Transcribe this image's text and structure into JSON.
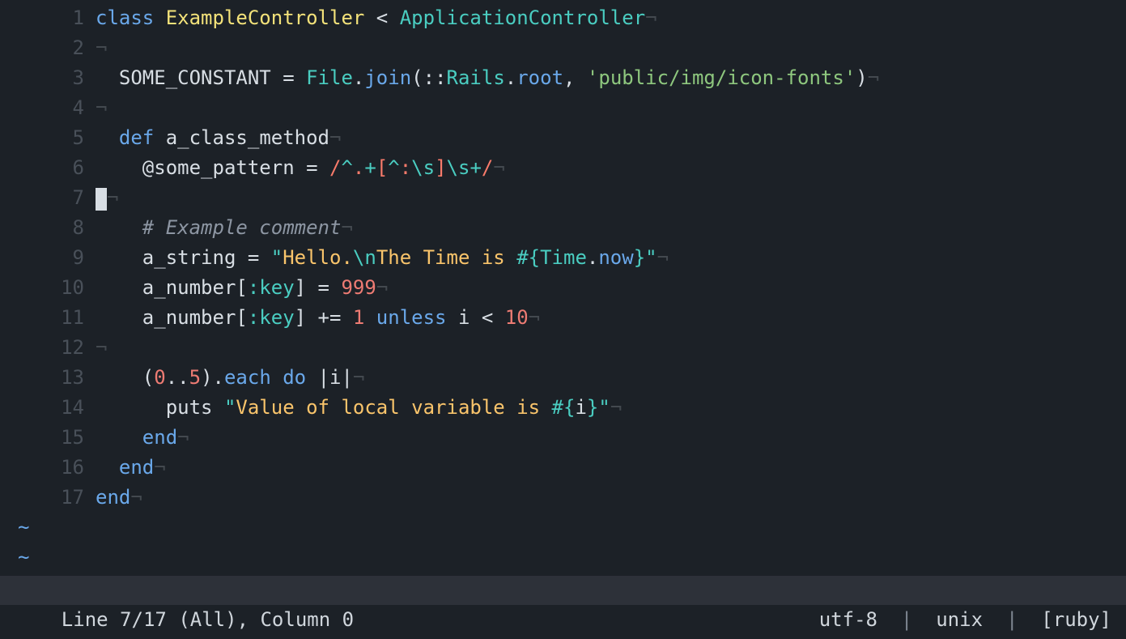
{
  "cursor": {
    "line": 7,
    "col": 0
  },
  "total_lines": 17,
  "lines": {
    "1": {
      "indent": 0,
      "segs": [
        {
          "cls": "kw",
          "t": "class"
        },
        {
          "cls": "clsname",
          "t": "ExampleController"
        },
        {
          "cls": "op",
          "t": "<"
        },
        {
          "cls": "parent",
          "t": "ApplicationController"
        }
      ]
    },
    "2": {
      "indent": 0,
      "segs": [],
      "blank": true
    },
    "3": {
      "indent": 2,
      "raw": true
    },
    "4": {
      "indent": 0,
      "segs": [],
      "blank": true
    },
    "5": {
      "indent": 2,
      "segs": [
        {
          "cls": "kw",
          "t": "def"
        },
        {
          "cls": "id",
          "t": "a_class_method"
        }
      ]
    },
    "6": {
      "indent": 4,
      "raw6": true
    },
    "7": {
      "indent": 0,
      "cursor": true
    },
    "8": {
      "indent": 4,
      "segs": [
        {
          "cls": "comment",
          "t": "# Example comment"
        }
      ]
    },
    "9": {
      "indent": 4,
      "raw9": true
    },
    "10": {
      "indent": 4,
      "raw10": true
    },
    "11": {
      "indent": 4,
      "raw11": true
    },
    "12": {
      "indent": 0,
      "segs": [],
      "blank": true
    },
    "13": {
      "indent": 4,
      "raw13": true
    },
    "14": {
      "indent": 6,
      "raw14": true
    },
    "15": {
      "indent": 4,
      "segs": [
        {
          "cls": "kw",
          "t": "end"
        }
      ]
    },
    "16": {
      "indent": 2,
      "segs": [
        {
          "cls": "kw",
          "t": "end"
        }
      ]
    },
    "17": {
      "indent": 0,
      "segs": [
        {
          "cls": "kw",
          "t": "end"
        }
      ]
    }
  },
  "tokens": {
    "l3": {
      "const": "SOME_CONSTANT",
      "eq": " = ",
      "klass": "File",
      "dot": ".",
      "method": "join",
      "p_open": "(",
      "cc": "::",
      "klass2": "Rails",
      "method2": "root",
      "comma": ", ",
      "q": "'",
      "str": "public/img/icon-fonts",
      "p_close": ")"
    },
    "l6": {
      "ivar": "@some_pattern",
      "eq": " = ",
      "re_open": "/",
      "anchor": "^",
      "dot": ".",
      "plus": "+",
      "br_open": "[",
      "neg": "^",
      "colon": ":",
      "esc_s": "\\s",
      "br_close": "]",
      "plus2": "+",
      "re_close": "/"
    },
    "l9": {
      "id": "a_string",
      "eq": " = ",
      "q": "\"",
      "s1": "Hello.",
      "nl": "\\n",
      "s2": "The Time is ",
      "ih": "#{",
      "klass": "Time",
      "dot": ".",
      "method": "now",
      "ic": "}"
    },
    "l10": {
      "id": "a_number",
      "br_o": "[",
      "sym": ":key",
      "br_c": "]",
      "eq": " = ",
      "num": "999"
    },
    "l11": {
      "id": "a_number",
      "br_o": "[",
      "sym": ":key",
      "br_c": "]",
      "peq": " += ",
      "one": "1",
      "unless": "unless",
      "i": "i",
      "lt": "<",
      "ten": "10"
    },
    "l13": {
      "p_o": "(",
      "zero": "0",
      "dd": "..",
      "five": "5",
      "p_c": ")",
      "dot": ".",
      "each": "each",
      "do": "do",
      "pipe": "|",
      "i": "i"
    },
    "l14": {
      "puts": "puts",
      "q": "\"",
      "s": "Value of local variable is ",
      "ih": "#{",
      "i": "i",
      "ic": "}"
    }
  },
  "status": {
    "line_label": "Line",
    "cur_line": "7",
    "total": "17",
    "all": "(All)",
    "col_label": "Column",
    "col": "0",
    "encoding": "utf-8",
    "sep": "|",
    "ff": "unix",
    "filetype": "[ruby]"
  },
  "tilde": "~",
  "eol_char": "¬"
}
